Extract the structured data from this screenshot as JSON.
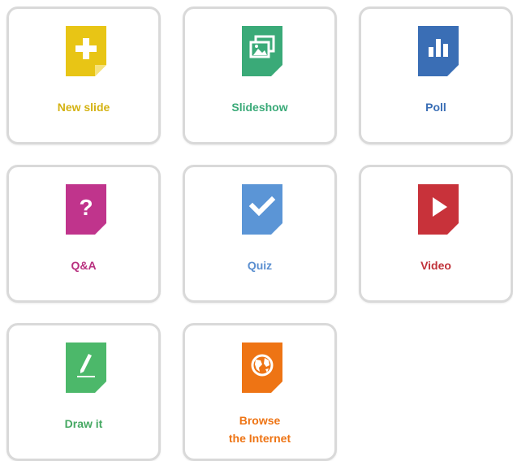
{
  "tiles": [
    {
      "label": "New slide",
      "icon": "plus-icon",
      "color": "#e8c515"
    },
    {
      "label": "Slideshow",
      "icon": "image-stack-icon",
      "color": "#3aaa78"
    },
    {
      "label": "Poll",
      "icon": "bar-chart-icon",
      "color": "#3a6eb5"
    },
    {
      "label": "Q&A",
      "icon": "question-mark-icon",
      "color": "#c0348c"
    },
    {
      "label": "Quiz",
      "icon": "checkmark-icon",
      "color": "#5b95d6"
    },
    {
      "label": "Video",
      "icon": "play-icon",
      "color": "#c8323a"
    },
    {
      "label": "Draw it",
      "icon": "pencil-icon",
      "color": "#4cb86a"
    },
    {
      "label": "Browse\nthe Internet",
      "icon": "globe-icon",
      "color": "#ee7414"
    }
  ]
}
